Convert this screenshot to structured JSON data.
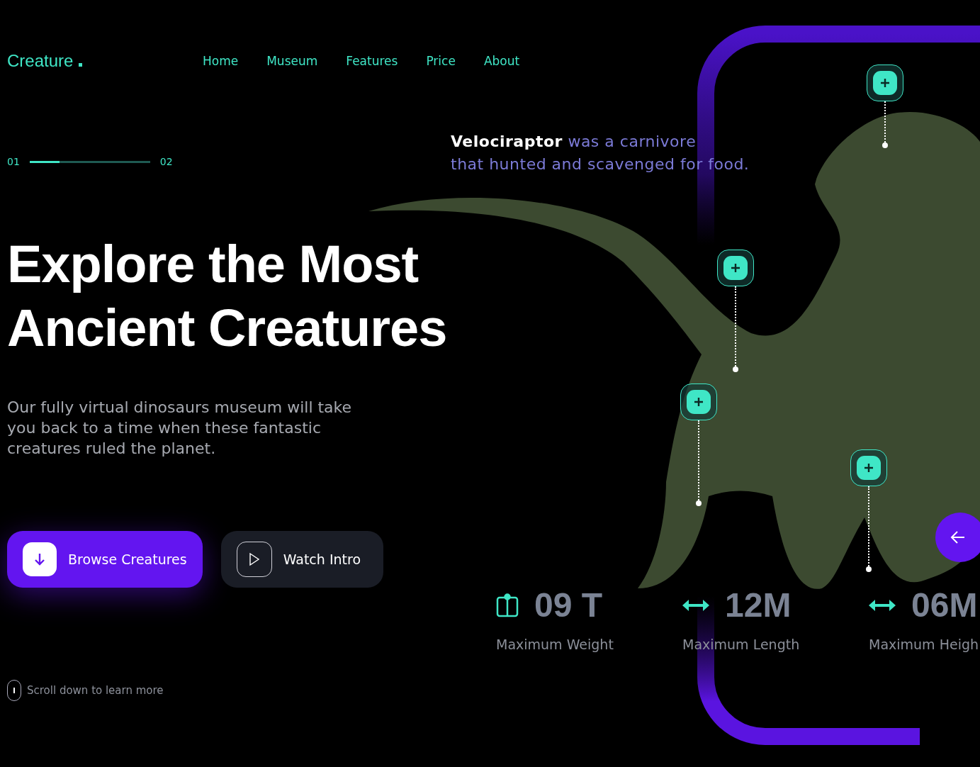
{
  "brand": "Creature",
  "nav": [
    "Home",
    "Museum",
    "Features",
    "Price",
    "About"
  ],
  "slider": {
    "start": "01",
    "end": "02",
    "level": 0.25
  },
  "caption": [
    "**Velociraptor** was a carnivore",
    "that hunted and scavenged for food."
  ],
  "headline": [
    "Explore the Most",
    "Ancient Creatures"
  ],
  "description": "Our fully virtual dinosaurs museum will take you back to a time when these fantastic creatures ruled the planet.",
  "buttons": [
    {
      "label": "Browse Creatures",
      "kind": "primary"
    },
    {
      "label": "Watch Intro",
      "kind": "secondary"
    }
  ],
  "scroll_hint": "Scroll down to learn more",
  "stats": [
    {
      "value": "09 T",
      "label": "Maximum Weight",
      "kind": "weight"
    },
    {
      "value": "12M",
      "label": "Maximum Length",
      "kind": "length"
    },
    {
      "value": "06M",
      "label": "Maximum Heigh",
      "kind": "length"
    }
  ]
}
